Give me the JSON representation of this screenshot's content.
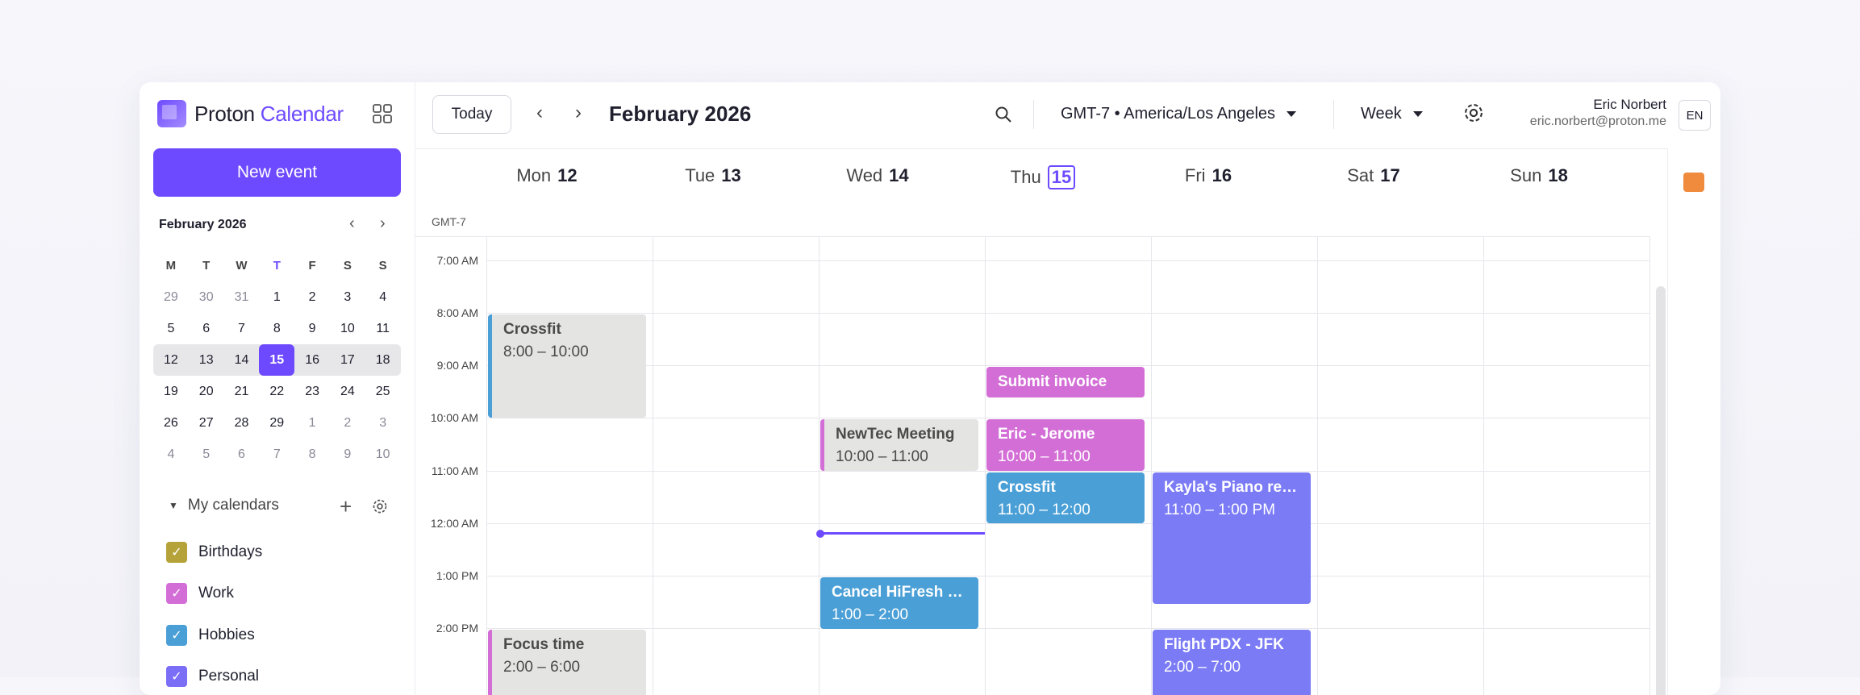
{
  "app": {
    "logo_brand": "Proton",
    "logo_product": "Calendar",
    "new_event_label": "New event"
  },
  "mini_calendar": {
    "title": "February 2026",
    "weekdays": [
      "M",
      "T",
      "W",
      "T",
      "F",
      "S",
      "S"
    ],
    "weeks": [
      [
        "29",
        "30",
        "31",
        "1",
        "2",
        "3",
        "4"
      ],
      [
        "5",
        "6",
        "7",
        "8",
        "9",
        "10",
        "11"
      ],
      [
        "12",
        "13",
        "14",
        "15",
        "16",
        "17",
        "18"
      ],
      [
        "19",
        "20",
        "21",
        "22",
        "23",
        "24",
        "25"
      ],
      [
        "26",
        "27",
        "28",
        "29",
        "1",
        "2",
        "3"
      ],
      [
        "4",
        "5",
        "6",
        "7",
        "8",
        "9",
        "10"
      ]
    ]
  },
  "calendars": {
    "heading": "My calendars",
    "items": [
      {
        "label": "Birthdays",
        "color": "#b5a33a"
      },
      {
        "label": "Work",
        "color": "#d36ed6"
      },
      {
        "label": "Hobbies",
        "color": "#4a9fd6"
      },
      {
        "label": "Personal",
        "color": "#7b6ef6"
      }
    ]
  },
  "toolbar": {
    "today_label": "Today",
    "period_title": "February 2026",
    "timezone": "GMT-7 • America/Los Angeles",
    "view": "Week",
    "user_name": "Eric Norbert",
    "user_email": "eric.norbert@proton.me",
    "language": "EN"
  },
  "week": {
    "gmt_label": "GMT-7",
    "days": [
      {
        "name": "Mon",
        "num": "12"
      },
      {
        "name": "Tue",
        "num": "13"
      },
      {
        "name": "Wed",
        "num": "14"
      },
      {
        "name": "Thu",
        "num": "15"
      },
      {
        "name": "Fri",
        "num": "16"
      },
      {
        "name": "Sat",
        "num": "17"
      },
      {
        "name": "Sun",
        "num": "18"
      }
    ],
    "hours": [
      "7:00 AM",
      "8:00 AM",
      "9:00 AM",
      "10:00 AM",
      "11:00 AM",
      "12:00 AM",
      "1:00 PM",
      "2:00 PM"
    ]
  },
  "events": [
    {
      "title": "Crossfit",
      "time": "8:00 – 10:00",
      "color": "#4a9fd6"
    },
    {
      "title": "Submit invoice",
      "time": "",
      "color": "#d36ed6"
    },
    {
      "title": "NewTec Meeting",
      "time": "10:00 – 11:00",
      "color": "#d36ed6"
    },
    {
      "title": "Eric - Jerome",
      "time": "10:00 – 11:00",
      "color": "#d36ed6"
    },
    {
      "title": "Crossfit",
      "time": "11:00 – 12:00",
      "color": "#4a9fd6"
    },
    {
      "title": "Kayla's Piano reci...",
      "time": "11:00 – 1:00 PM",
      "color": "#7b7bf6"
    },
    {
      "title": "Cancel HiFresh s...",
      "time": "1:00 – 2:00",
      "color": "#4a9fd6"
    },
    {
      "title": "Focus time",
      "time": "2:00 – 6:00",
      "color": "#d36ed6"
    },
    {
      "title": "Flight PDX - JFK",
      "time": "2:00 – 7:00",
      "color": "#7b7bf6"
    }
  ]
}
